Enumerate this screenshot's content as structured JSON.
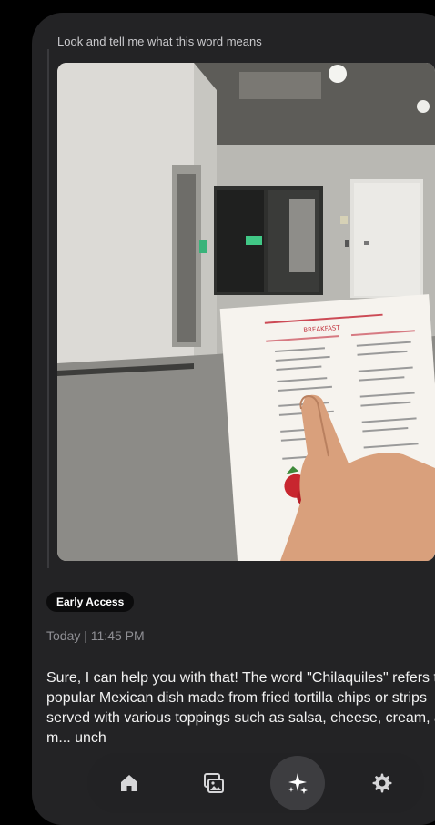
{
  "prompt": {
    "text": "Look and tell me what this word means"
  },
  "photo": {
    "alt": "Hand pointing at a breakfast menu in a hallway",
    "menu_heading": "BREAKFAST"
  },
  "badge": {
    "label": "Early Access"
  },
  "timestamp": {
    "text": "Today | 11:45 PM"
  },
  "response": {
    "text": "Sure, I can help you with that! The word \"Chilaquiles\" refers to a popular Mexican dish made from fried tortilla chips or strips served with various toppings such as salsa, cheese, cream, and m... unch"
  },
  "navbar": {
    "items": [
      {
        "icon": "home-icon",
        "active": false
      },
      {
        "icon": "gallery-icon",
        "active": false
      },
      {
        "icon": "sparkle-icon",
        "active": true
      },
      {
        "icon": "gear-icon",
        "active": false
      }
    ]
  },
  "colors": {
    "background": "#000000",
    "panel": "#232325",
    "text_primary": "#f2f2f2",
    "text_muted": "#8f8f94",
    "badge_bg": "#0b0b0c"
  }
}
